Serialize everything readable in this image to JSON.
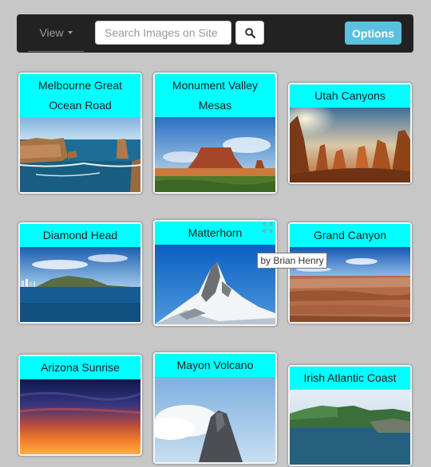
{
  "navbar": {
    "view_label": "View",
    "search_placeholder": "Search Images on Site",
    "options_label": "Options"
  },
  "cards": [
    {
      "title": "Melbourne Great Ocean Road"
    },
    {
      "title": "Monument Valley Mesas"
    },
    {
      "title": "Utah Canyons"
    },
    {
      "title": "Diamond Head"
    },
    {
      "title": "Matterhorn"
    },
    {
      "title": "Grand Canyon"
    },
    {
      "title": "Arizona Sunrise"
    },
    {
      "title": "Mayon Volcano"
    },
    {
      "title": "Irish Atlantic Coast"
    }
  ],
  "tooltip": {
    "text": "by Brian Henry"
  },
  "icons": {
    "search": "search-icon",
    "expand": "expand-icon"
  },
  "colors": {
    "title_bg": "#00ffff",
    "accent": "#5bc0de",
    "navbar_bg": "#222222"
  }
}
